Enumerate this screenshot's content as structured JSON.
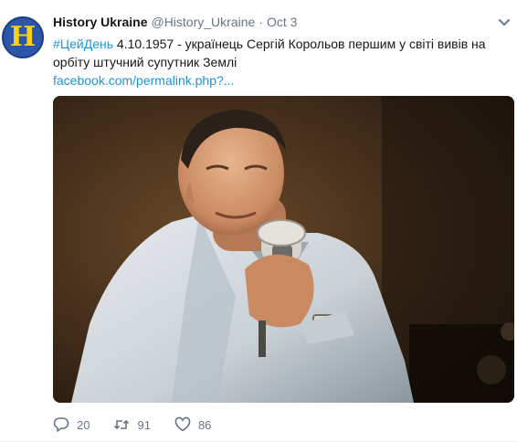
{
  "tweet": {
    "avatar_letter": "H",
    "author_name": "History Ukraine",
    "handle": "@History_Ukraine",
    "separator": "·",
    "time": "Oct 3",
    "hashtag": "#ЦейДень",
    "body": " 4.10.1957 - українець Сергій Корольов першим у світі вивів на орбіту штучний супутник Землі",
    "link": "facebook.com/permalink.php?...",
    "image_icon": "photo",
    "counts": {
      "reply": "20",
      "retweet": "91",
      "like": "86"
    },
    "icons": {
      "reply": "reply-icon",
      "retweet": "retweet-icon",
      "like": "heart-icon",
      "menu": "chevron-down-icon"
    },
    "colors": {
      "accent": "#1b95e0",
      "muted": "#657786",
      "avatar_bg": "#2c56a8",
      "avatar_letter": "#f7d11a"
    }
  }
}
